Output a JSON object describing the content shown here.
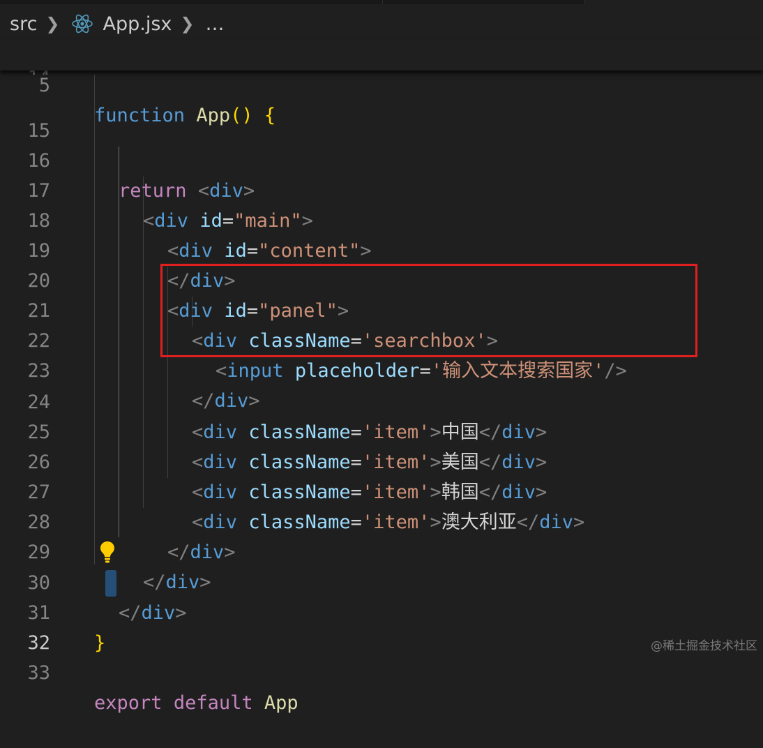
{
  "breadcrumb": {
    "folder": "src",
    "file": "App.jsx",
    "more": "…"
  },
  "sticky": {
    "line_number": "5",
    "keyword": "function",
    "name": "App",
    "parens": "()",
    "brace": "{"
  },
  "lines": [
    {
      "n": "14",
      "text": "}, []);"
    },
    {
      "n": "15",
      "text": ""
    },
    {
      "n": "16",
      "text": "return <div>"
    },
    {
      "n": "17",
      "text": "<div id=\"main\">"
    },
    {
      "n": "18",
      "text": "<div id=\"content\">"
    },
    {
      "n": "19",
      "text": "</div>"
    },
    {
      "n": "20",
      "text": "<div id=\"panel\">"
    },
    {
      "n": "21",
      "text": "<div className='searchbox'>"
    },
    {
      "n": "22",
      "text": "<input placeholder='输入文本搜索国家'/>"
    },
    {
      "n": "23",
      "text": "</div>"
    },
    {
      "n": "24",
      "text": "<div className='item'>中国</div>"
    },
    {
      "n": "25",
      "text": "<div className='item'>美国</div>"
    },
    {
      "n": "26",
      "text": "<div className='item'>韩国</div>"
    },
    {
      "n": "27",
      "text": "<div className='item'>澳大利亚</div>"
    },
    {
      "n": "28",
      "text": "</div>"
    },
    {
      "n": "29",
      "text": "</div>"
    },
    {
      "n": "30",
      "text": "</div>"
    },
    {
      "n": "31",
      "text": "}"
    },
    {
      "n": "32",
      "text": ""
    },
    {
      "n": "33",
      "text": "export default App"
    }
  ],
  "tokens": {
    "l14a": "}",
    "l14b": ", ",
    "l14c": "[]",
    "l14d": ");",
    "return": "return",
    "lt": "<",
    "gt": ">",
    "lts": "</",
    "sgt": "/>",
    "div": "div",
    "input": "input",
    "id": "id",
    "eq": "=",
    "className": "className",
    "placeholder": "placeholder",
    "main": "\"main\"",
    "content": "\"content\"",
    "panel": "\"panel\"",
    "searchbox": "'searchbox'",
    "ph_value": "'输入文本搜索国家'",
    "item": "'item'",
    "china": "中国",
    "usa": "美国",
    "korea": "韩国",
    "australia": "澳大利亚",
    "close_brace": "}",
    "export": "export",
    "default": "default",
    "app": "App"
  },
  "active_line": "32",
  "watermark": "@稀土掘金技术社区",
  "colors": {
    "background": "#1f1f1f",
    "highlight_box": "#e02020",
    "keyword": "#569cd6",
    "control": "#c586c0",
    "string": "#ce9178",
    "attribute": "#9cdcfe",
    "function": "#dcdcaa",
    "bracket": "#ffd700"
  }
}
